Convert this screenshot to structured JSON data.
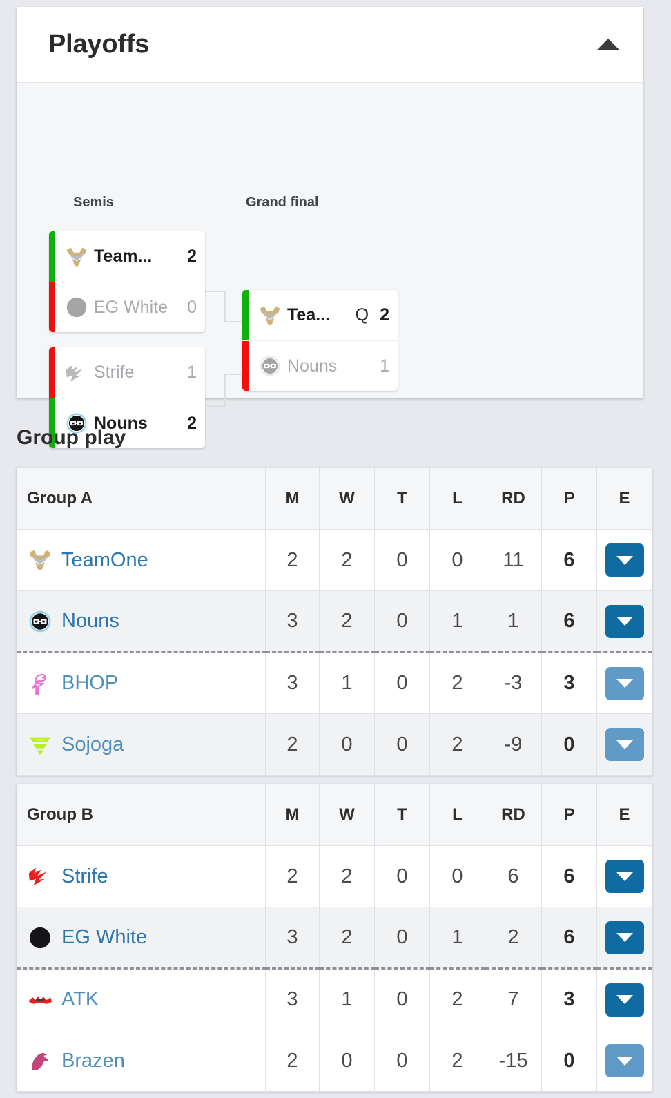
{
  "playoffs": {
    "title": "Playoffs",
    "collapse_icon": "triangle-up-icon",
    "rounds": [
      {
        "label": "Semis"
      },
      {
        "label": "Grand final"
      }
    ],
    "matches": [
      {
        "id": "semi-1",
        "round": "Semis",
        "rows": [
          {
            "team": "Team...",
            "full_team": "TeamOne",
            "logo": "teamone-logo",
            "score": "2",
            "result": "win",
            "qualifier": ""
          },
          {
            "team": "EG White",
            "full_team": "EG White",
            "logo": "egwhite-logo",
            "score": "0",
            "result": "lose",
            "qualifier": ""
          }
        ]
      },
      {
        "id": "semi-2",
        "round": "Semis",
        "rows": [
          {
            "team": "Strife",
            "full_team": "Strife",
            "logo": "strife-logo",
            "score": "1",
            "result": "lose",
            "qualifier": ""
          },
          {
            "team": "Nouns",
            "full_team": "Nouns",
            "logo": "nouns-logo",
            "score": "2",
            "result": "win",
            "qualifier": ""
          }
        ]
      },
      {
        "id": "grand-final",
        "round": "Grand final",
        "rows": [
          {
            "team": "Tea...",
            "full_team": "TeamOne",
            "logo": "teamone-logo",
            "score": "2",
            "result": "win",
            "qualifier": "Q"
          },
          {
            "team": "Nouns",
            "full_team": "Nouns",
            "logo": "nouns-logo",
            "score": "1",
            "result": "lose",
            "qualifier": ""
          }
        ]
      }
    ]
  },
  "group_play": {
    "title": "Group play",
    "columns": [
      "M",
      "W",
      "T",
      "L",
      "RD",
      "P",
      "E"
    ],
    "expand_icon": "triangle-down-icon",
    "groups": [
      {
        "name": "Group A",
        "cutoff_after_index": 1,
        "rows": [
          {
            "team": "TeamOne",
            "logo": "teamone-logo",
            "m": "2",
            "w": "2",
            "t": "0",
            "l": "0",
            "rd": "11",
            "p": "6",
            "qualified": true
          },
          {
            "team": "Nouns",
            "logo": "nouns-logo",
            "m": "3",
            "w": "2",
            "t": "0",
            "l": "1",
            "rd": "1",
            "p": "6",
            "qualified": true
          },
          {
            "team": "BHOP",
            "logo": "bhop-logo",
            "m": "3",
            "w": "1",
            "t": "0",
            "l": "2",
            "rd": "-3",
            "p": "3",
            "qualified": false
          },
          {
            "team": "Sojoga",
            "logo": "sojoga-logo",
            "m": "2",
            "w": "0",
            "t": "0",
            "l": "2",
            "rd": "-9",
            "p": "0",
            "qualified": false
          }
        ]
      },
      {
        "name": "Group B",
        "cutoff_after_index": 1,
        "rows": [
          {
            "team": "Strife",
            "logo": "strife-logo",
            "m": "2",
            "w": "2",
            "t": "0",
            "l": "0",
            "rd": "6",
            "p": "6",
            "qualified": true
          },
          {
            "team": "EG White",
            "logo": "egwhite-logo",
            "m": "3",
            "w": "2",
            "t": "0",
            "l": "1",
            "rd": "2",
            "p": "6",
            "qualified": true
          },
          {
            "team": "ATK",
            "logo": "atk-logo",
            "m": "3",
            "w": "1",
            "t": "0",
            "l": "2",
            "rd": "7",
            "p": "3",
            "qualified": false
          },
          {
            "team": "Brazen",
            "logo": "brazen-logo",
            "m": "2",
            "w": "0",
            "t": "0",
            "l": "2",
            "rd": "-15",
            "p": "0",
            "qualified": false
          }
        ]
      }
    ]
  },
  "colors": {
    "page_background": "#e7e9ee",
    "card_background": "#ffffff",
    "bracket_background": "#f5f6f8",
    "winner_bar": "#0cb10c",
    "loser_bar": "#f40d0d",
    "team_link": "#2d76ab",
    "expand_button_qualified": "#116ba3",
    "expand_button_eliminated": "#5f9bc6",
    "cutoff_line": "#8e9298"
  }
}
